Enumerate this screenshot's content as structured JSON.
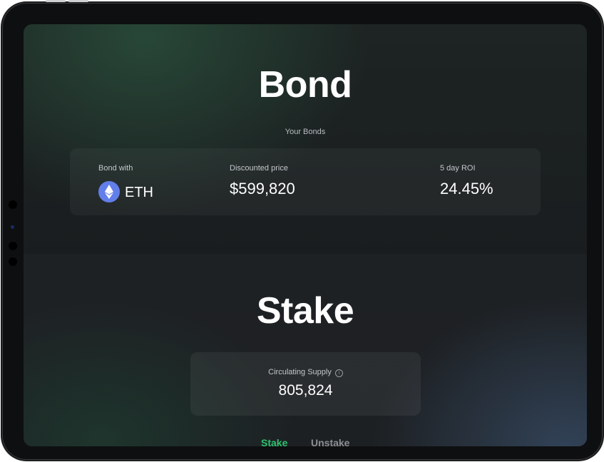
{
  "bond": {
    "title": "Bond",
    "your_bonds_label": "Your Bonds",
    "bond_with_label": "Bond with",
    "token": "ETH",
    "token_icon": "ethereum-icon",
    "discounted_price_label": "Discounted price",
    "discounted_price_value": "$599,820",
    "roi_label": "5 day ROI",
    "roi_value": "24.45%"
  },
  "stake": {
    "title": "Stake",
    "circulating_supply_label": "Circulating Supply",
    "circulating_supply_value": "805,824",
    "info_icon": "info-icon",
    "tabs": [
      {
        "label": "Stake",
        "active": true
      },
      {
        "label": "Unstake",
        "active": false
      }
    ]
  },
  "colors": {
    "accent": "#2fc16f",
    "eth_brand": "#627eea",
    "inactive_tab": "#8b8e93"
  }
}
